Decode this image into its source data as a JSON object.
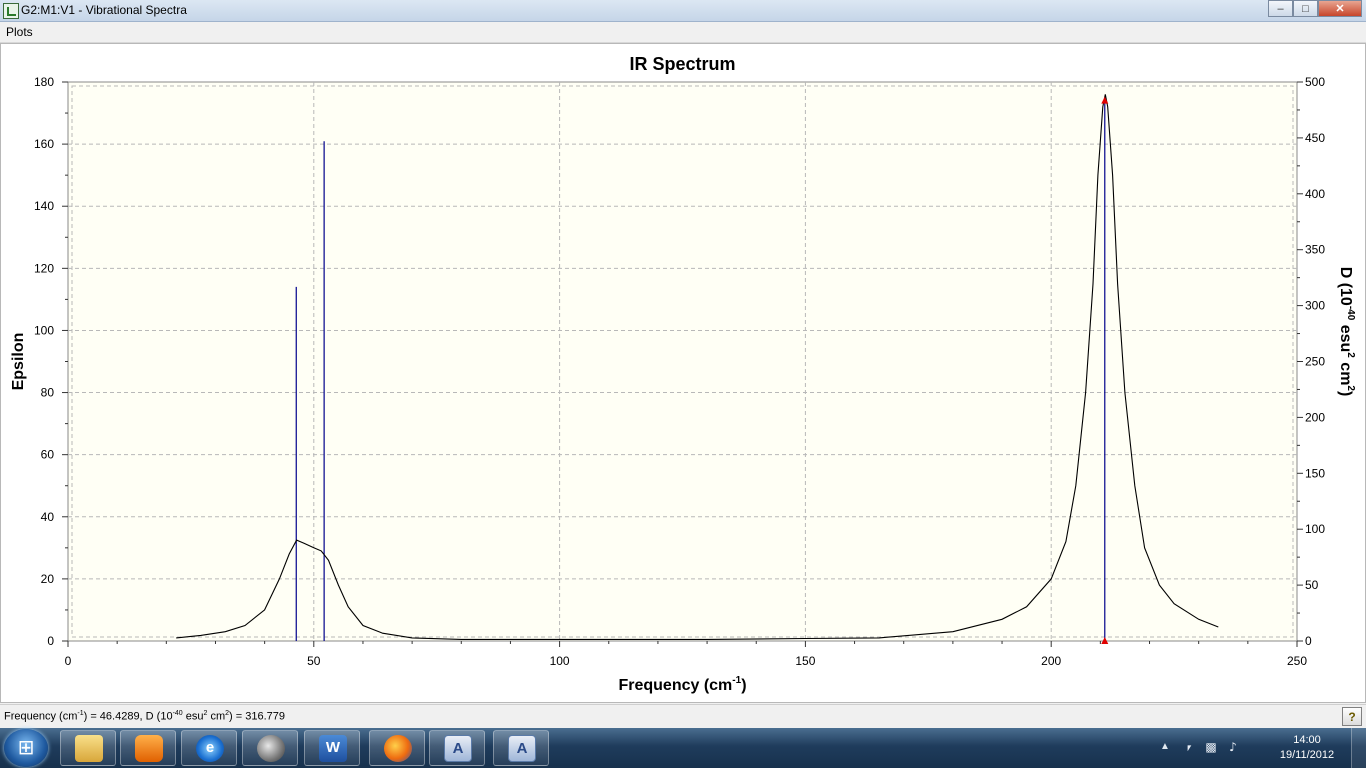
{
  "window": {
    "title": "G2:M1:V1 - Vibrational Spectra"
  },
  "menu": {
    "plots": "Plots"
  },
  "status": {
    "pre": "Frequency (cm",
    "sup1": "-1",
    "mid1": ") = 46.4289, D (10",
    "sup2": "-40",
    "mid2": " esu",
    "sup3": "2",
    "mid3": " cm",
    "sup4": "2",
    "post": ") = 316.779",
    "help": "?"
  },
  "taskbar": {
    "items": [
      {
        "name": "Windows Explorer",
        "icon": "folder-icon"
      },
      {
        "name": "Windows Media Player",
        "icon": "media-player-icon"
      },
      {
        "name": "Internet Explorer",
        "icon": "internet-explorer-icon",
        "glyph": "e"
      },
      {
        "name": "GaussView",
        "icon": "gaussview-icon"
      },
      {
        "name": "Microsoft Word",
        "icon": "word-icon",
        "glyph": "W"
      },
      {
        "name": "Firefox",
        "icon": "firefox-icon"
      },
      {
        "name": "Document 1",
        "icon": "document-icon",
        "glyph": "A"
      },
      {
        "name": "Document 2",
        "icon": "document-icon",
        "glyph": "A"
      }
    ],
    "time": "14:00",
    "date": "19/11/2012"
  },
  "chart_data": {
    "type": "line",
    "title": "IR Spectrum",
    "xlabel": "Frequency (cm-1)",
    "ylabel": "Epsilon",
    "y2label": "D (10-40 esu2 cm2)",
    "xlim": [
      0,
      250
    ],
    "ylim": [
      0,
      180
    ],
    "y2lim": [
      0,
      500
    ],
    "xticks": [
      0,
      50,
      100,
      150,
      200,
      250
    ],
    "yticks": [
      0,
      20,
      40,
      60,
      80,
      100,
      120,
      140,
      160,
      180
    ],
    "y2ticks": [
      0,
      50,
      100,
      150,
      200,
      250,
      300,
      350,
      400,
      450,
      500
    ],
    "grid": true,
    "colors": {
      "background": "#fffff5",
      "curve": "#000000",
      "sticks": "#00008b",
      "marker": "#e00000",
      "grid": "#b8b8b8"
    },
    "series": [
      {
        "name": "Epsilon",
        "axis": "left",
        "x": [
          22,
          27,
          32,
          36,
          40,
          43,
          45,
          46.5,
          48,
          50,
          51.5,
          53,
          55,
          57,
          60,
          64,
          70,
          80,
          100,
          130,
          150,
          165,
          180,
          190,
          195,
          200,
          203,
          205,
          207,
          208.5,
          209.5,
          210.5,
          211,
          211.5,
          212.5,
          213.5,
          215,
          217,
          219,
          222,
          225,
          230,
          234
        ],
        "y": [
          1,
          1.8,
          3,
          5,
          10,
          20,
          28,
          32.5,
          31.5,
          30,
          29,
          26,
          18,
          11,
          5,
          2.5,
          1,
          0.5,
          0.5,
          0.5,
          0.8,
          1,
          3,
          7,
          11,
          20,
          32,
          50,
          80,
          115,
          150,
          172,
          176,
          172,
          150,
          115,
          80,
          50,
          30,
          18,
          12,
          7,
          4.5
        ]
      }
    ],
    "sticks": [
      {
        "x": 46.43,
        "d": 316.779
      },
      {
        "x": 52.1,
        "d": 447
      },
      {
        "x": 210.9,
        "d": 485
      }
    ],
    "markers": [
      {
        "x": 210.9,
        "epsilon": 174
      },
      {
        "x": 210.9,
        "epsilon": 0
      }
    ]
  }
}
